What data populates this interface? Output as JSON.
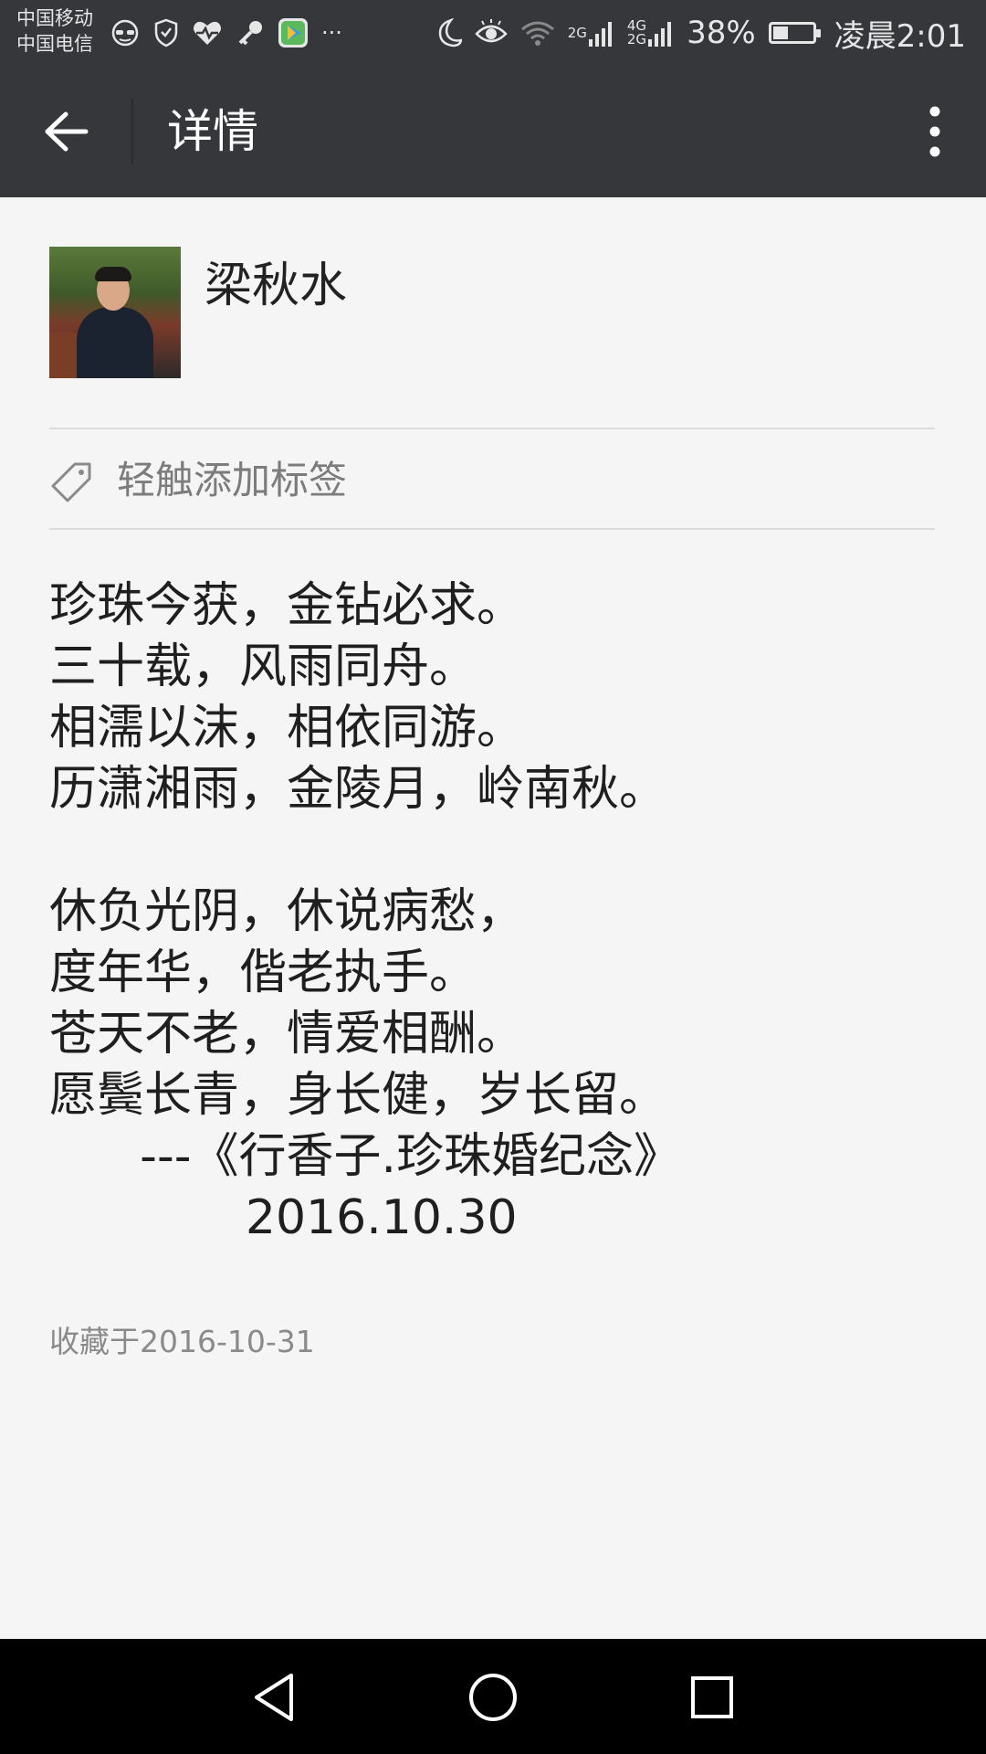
{
  "status_bar": {
    "carrier_1": "中国移动",
    "carrier_2": "中国电信",
    "more_indicator": "···",
    "network_2g": "2G",
    "network_4g": "4G",
    "network_2g_b": "2G",
    "battery_percent": "38%",
    "battery_level": 0.38,
    "time": "凌晨2:01",
    "icons": [
      "glasses-icon",
      "shield-icon",
      "heart-pulse-icon",
      "key-icon",
      "video-app-icon",
      "moon-icon",
      "eye-icon",
      "wifi-icon",
      "signal-icon",
      "battery-icon"
    ]
  },
  "app_bar": {
    "title": "详情",
    "back_icon": "arrow-left-icon",
    "more_icon": "more-vertical-icon"
  },
  "profile": {
    "name": "梁秋水",
    "avatar_icon": "avatar-photo"
  },
  "tag": {
    "label": "轻触添加标签",
    "icon": "tag-icon"
  },
  "note": {
    "lines": [
      "珍珠今获，金钻必求。",
      "三十载，风雨同舟。",
      "相濡以沫，相依同游。",
      "历潇湘雨，金陵月，岭南秋。",
      "",
      "休负光阴，休说病愁，",
      "度年华，偕老执手。",
      "苍天不老，情爱相酬。",
      "愿鬓长青，身长健，岁长留。",
      "      ---《行香子.珍珠婚纪念》",
      "             2016.10.30"
    ]
  },
  "saved_label": "收藏于2016-10-31",
  "nav_bar": {
    "back_icon": "triangle-back-icon",
    "home_icon": "circle-home-icon",
    "recents_icon": "square-recents-icon"
  },
  "colors": {
    "bar_bg": "#36373b",
    "page_bg": "#f5f5f5",
    "nav_bg": "#000000"
  }
}
